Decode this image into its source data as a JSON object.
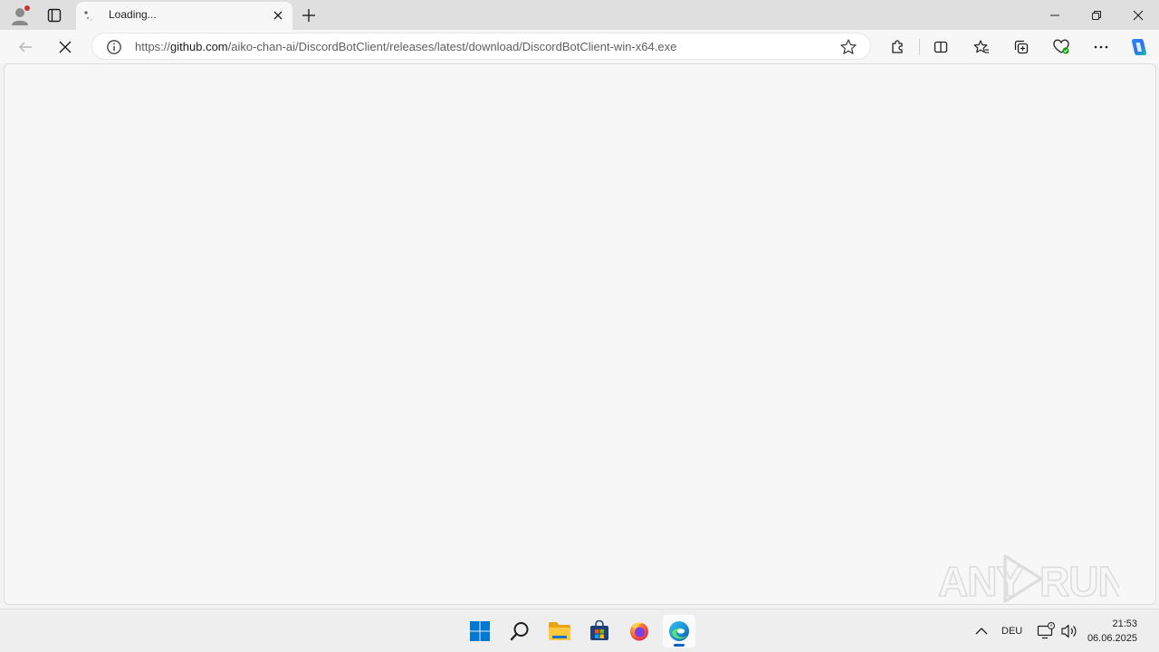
{
  "tab": {
    "title": "Loading..."
  },
  "address": {
    "scheme": "https://",
    "host": "github.com",
    "path": "/aiko-chan-ai/DiscordBotClient/releases/latest/download/DiscordBotClient-win-x64.exe"
  },
  "watermark": {
    "text": "ANY RUN"
  },
  "taskbar": {
    "language": "DEU",
    "time": "21:53",
    "date": "06.06.2025"
  },
  "colors": {
    "accent": "#0067c0",
    "notification_dot": "#d13438"
  }
}
